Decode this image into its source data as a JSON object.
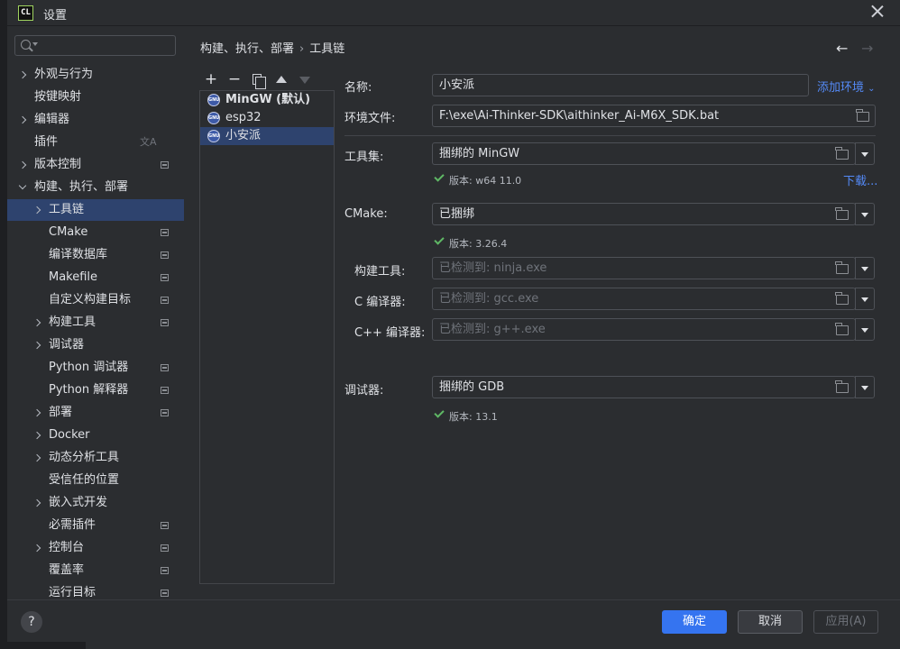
{
  "window": {
    "app_icon": "CL",
    "title": "设置"
  },
  "search": {
    "placeholder": ""
  },
  "nav": {
    "items": [
      {
        "label": "外观与行为",
        "chevron": true
      },
      {
        "label": "按键映射"
      },
      {
        "label": "编辑器",
        "chevron": true
      },
      {
        "label": "插件",
        "translate_icon": "文A"
      },
      {
        "label": "版本控制",
        "chevron": true,
        "project_icon": true
      },
      {
        "label": "构建、执行、部署",
        "chevron": true,
        "open": true
      },
      {
        "label": "工具链",
        "chevron": true,
        "selected": true
      },
      {
        "label": "CMake",
        "project_icon": true
      },
      {
        "label": "编译数据库",
        "project_icon": true
      },
      {
        "label": "Makefile",
        "project_icon": true
      },
      {
        "label": "自定义构建目标",
        "project_icon": true
      },
      {
        "label": "构建工具",
        "chevron": true,
        "project_icon": true
      },
      {
        "label": "调试器",
        "chevron": true
      },
      {
        "label": "Python 调试器",
        "project_icon": true
      },
      {
        "label": "Python 解释器",
        "project_icon": true
      },
      {
        "label": "部署",
        "chevron": true,
        "project_icon": true
      },
      {
        "label": "Docker",
        "chevron": true
      },
      {
        "label": "动态分析工具",
        "chevron": true
      },
      {
        "label": "受信任的位置"
      },
      {
        "label": "嵌入式开发",
        "chevron": true
      },
      {
        "label": "必需插件",
        "project_icon": true
      },
      {
        "label": "控制台",
        "chevron": true,
        "project_icon": true
      },
      {
        "label": "覆盖率",
        "project_icon": true
      },
      {
        "label": "运行目标",
        "project_icon": true
      }
    ]
  },
  "breadcrumb": {
    "parent": "构建、执行、部署",
    "separator": "›",
    "current": "工具链"
  },
  "nav_arrows": {
    "back": "←",
    "forward": "→"
  },
  "toolbar": {
    "add": "+",
    "remove": "−",
    "copy": "copy-icon",
    "up": "move-up-icon",
    "down": "move-down-icon"
  },
  "toolchains": [
    {
      "icon": "GNU",
      "name": "MinGW (默认)",
      "bold": true
    },
    {
      "icon": "GNU",
      "name": "esp32"
    },
    {
      "icon": "GNU",
      "name": "小安派",
      "selected": true
    }
  ],
  "form": {
    "name_label": "名称:",
    "name_value": "小安派",
    "add_env_label": "添加环境",
    "env_file_label": "环境文件:",
    "env_file_value": "F:\\exe\\Ai-Thinker-SDK\\aithinker_Ai-M6X_SDK.bat",
    "toolset_label": "工具集:",
    "toolset_value": "捆绑的 MinGW",
    "toolset_version": "版本: w64 11.0",
    "download_label": "下载...",
    "cmake_label": "CMake:",
    "cmake_value": "已捆绑",
    "cmake_version": "版本: 3.26.4",
    "build_tool_label": "构建工具:",
    "build_tool_value": "已检测到: ninja.exe",
    "c_compiler_label": "C 编译器:",
    "c_compiler_value": "已检测到: gcc.exe",
    "cpp_compiler_label": "C++ 编译器:",
    "cpp_compiler_value": "已检测到: g++.exe",
    "debugger_label": "调试器:",
    "debugger_value": "捆绑的 GDB",
    "debugger_version": "版本: 13.1"
  },
  "footer": {
    "help": "?",
    "ok": "确定",
    "cancel": "取消",
    "apply": "应用(A)"
  },
  "colors": {
    "accent": "#3574f0",
    "selection": "#2e436e",
    "link": "#548af7",
    "check": "#5fb865"
  }
}
